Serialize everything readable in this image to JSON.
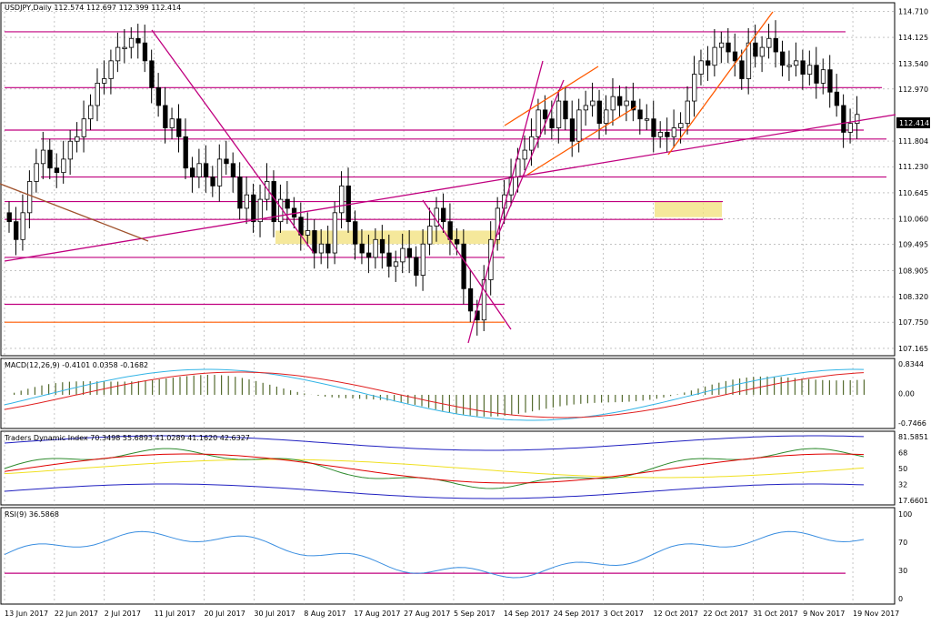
{
  "window": {
    "title": "USDJPY,Daily  112.574 112.697 112.399 112.414"
  },
  "current_price": "112.414",
  "x_axis": {
    "dates": [
      "13 Jun 2017",
      "22 Jun 2017",
      "2 Jul 2017",
      "11 Jul 2017",
      "20 Jul 2017",
      "30 Jul 2017",
      "8 Aug 2017",
      "17 Aug 2017",
      "27 Aug 2017",
      "5 Sep 2017",
      "14 Sep 2017",
      "24 Sep 2017",
      "3 Oct 2017",
      "12 Oct 2017",
      "22 Oct 2017",
      "31 Oct 2017",
      "9 Nov 2017",
      "19 Nov 2017"
    ]
  },
  "indicators": {
    "macd": {
      "label": "MACD(12,26,9) -0.4101 0.0358 -0.1682",
      "ticks": [
        "0.8344",
        "0.00",
        "-0.7466"
      ]
    },
    "tdi": {
      "label": "Traders Dynamic Index 70.3498 55.6893 41.0289 41.1620 42.6327",
      "ticks": [
        "81.5851",
        "68",
        "50",
        "32",
        "17.6601"
      ]
    },
    "rsi": {
      "label": "RSI(9) 36.5868",
      "ticks": [
        "100",
        "70",
        "30",
        "0"
      ]
    }
  },
  "colors": {
    "trendline": "#c0007f",
    "orange": "#ff5a00",
    "brown": "#a0522d",
    "zone": "#f2e07a",
    "macd_signal": "#e02020",
    "macd_line": "#32b4e6",
    "histogram": "#556b2f",
    "tdi_green": "#2e8b2e",
    "tdi_red": "#e00000",
    "tdi_yellow": "#f0e020",
    "tdi_blue": "#2020c0",
    "rsi_line": "#3a8ee0",
    "grid": "#a0a0a0"
  },
  "chart_data": {
    "type": "candlestick",
    "symbol": "USDJPY",
    "timeframe": "Daily",
    "ohlc_header": {
      "open": 112.574,
      "high": 112.697,
      "low": 112.399,
      "close": 112.414
    },
    "y_ticks": [
      "114.710",
      "114.125",
      "113.540",
      "112.970",
      "111.804",
      "111.230",
      "110.645",
      "110.060",
      "109.495",
      "108.905",
      "108.320",
      "107.750",
      "107.165"
    ],
    "ylim": [
      107.165,
      114.71
    ],
    "x_categories": [
      "13 Jun 2017",
      "22 Jun 2017",
      "2 Jul 2017",
      "11 Jul 2017",
      "20 Jul 2017",
      "30 Jul 2017",
      "8 Aug 2017",
      "17 Aug 2017",
      "27 Aug 2017",
      "5 Sep 2017",
      "14 Sep 2017",
      "24 Sep 2017",
      "3 Oct 2017",
      "12 Oct 2017",
      "22 Oct 2017",
      "31 Oct 2017",
      "9 Nov 2017",
      "19 Nov 2017"
    ],
    "candles_close_path": [
      110.0,
      109.6,
      110.2,
      110.9,
      111.3,
      111.6,
      111.2,
      111.1,
      111.4,
      111.8,
      111.9,
      112.3,
      112.6,
      113.1,
      113.2,
      113.6,
      113.9,
      113.9,
      114.1,
      114.0,
      113.6,
      113.0,
      112.6,
      112.1,
      112.3,
      111.9,
      111.2,
      111.0,
      111.3,
      111.0,
      110.8,
      111.4,
      111.3,
      111.0,
      110.3,
      110.6,
      110.0,
      110.5,
      110.9,
      110.0,
      110.5,
      110.3,
      110.1,
      109.7,
      109.8,
      109.3,
      109.5,
      109.3,
      110.2,
      110.8,
      110.0,
      109.5,
      109.3,
      109.2,
      109.6,
      109.3,
      109.0,
      109.1,
      109.4,
      109.2,
      108.8,
      109.5,
      109.9,
      110.3,
      110.0,
      109.6,
      109.5,
      108.5,
      108.0,
      107.8,
      108.7,
      109.6,
      110.3,
      110.6,
      111.0,
      111.4,
      111.6,
      111.9,
      112.5,
      112.3,
      112.1,
      112.7,
      112.3,
      111.8,
      112.5,
      112.6,
      112.7,
      112.2,
      112.5,
      112.8,
      112.6,
      112.7,
      112.5,
      112.3,
      112.3,
      111.9,
      112.0,
      111.9,
      112.1,
      112.2,
      112.7,
      113.3,
      113.6,
      113.5,
      113.9,
      114.0,
      113.8,
      113.6,
      113.2,
      114.0,
      113.7,
      113.9,
      114.1,
      113.8,
      113.5,
      113.5,
      113.6,
      113.3,
      113.5,
      113.1,
      113.4,
      112.9,
      112.6,
      112.0,
      112.2,
      112.4
    ],
    "horizontal_levels": [
      114.25,
      113.0,
      112.05,
      111.85,
      111.0,
      110.45,
      110.05,
      109.2,
      108.15,
      107.75
    ],
    "zones": [
      {
        "from": "30 Jul 2017",
        "to": "14 Sep 2017",
        "low": 109.5,
        "high": 109.8
      },
      {
        "from": "12 Oct 2017",
        "to": "22 Oct 2017",
        "low": 110.1,
        "high": 110.45
      }
    ],
    "macd": {
      "labels": [
        "0.8344",
        "0.00",
        "-0.7466"
      ],
      "range": [
        -0.7466,
        0.8344
      ]
    },
    "tdi": {
      "labels": [
        "81.5851",
        "68",
        "50",
        "32",
        "17.6601"
      ],
      "range": [
        17.6601,
        81.5851
      ]
    },
    "rsi": {
      "labels": [
        "100",
        "70",
        "30",
        "0"
      ],
      "range": [
        0,
        100
      ],
      "levels": [
        70,
        30
      ]
    }
  }
}
